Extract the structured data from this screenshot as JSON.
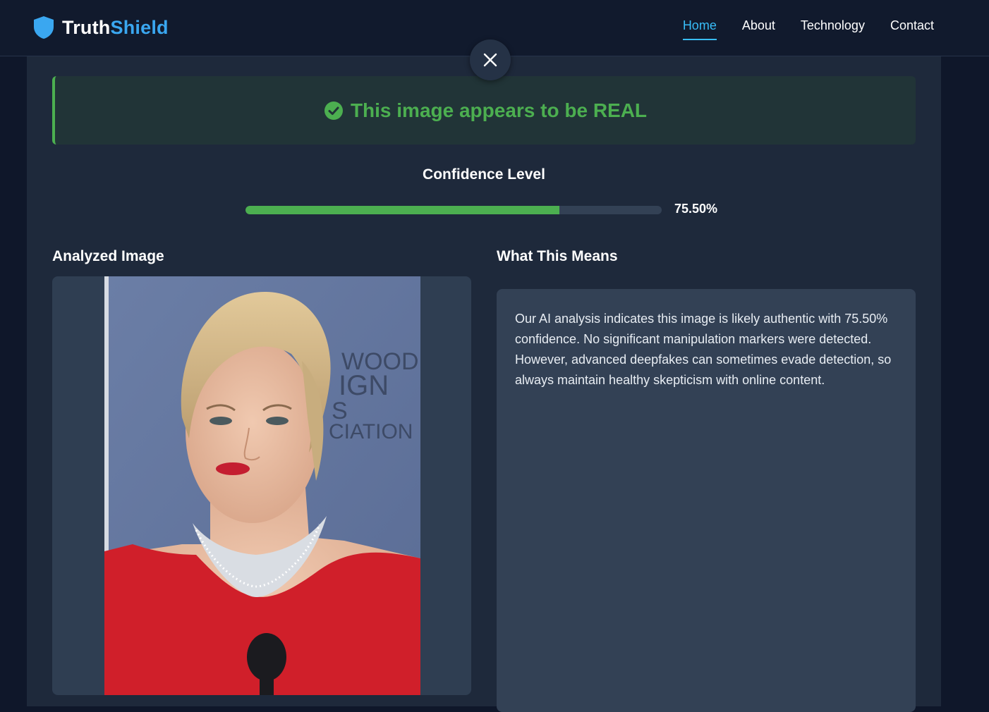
{
  "header": {
    "brand_part1": "Truth",
    "brand_part2": "Shield",
    "logo_icon": "shield-icon",
    "nav": [
      {
        "label": "Home",
        "active": true
      },
      {
        "label": "About",
        "active": false
      },
      {
        "label": "Technology",
        "active": false
      },
      {
        "label": "Contact",
        "active": false
      }
    ]
  },
  "modal": {
    "close_icon": "close-icon",
    "verdict": {
      "icon": "check-circle-icon",
      "text": "This image appears to be REAL",
      "color": "#4caf50"
    },
    "confidence": {
      "title": "Confidence Level",
      "value_label": "75.50%",
      "fraction": 0.755,
      "bar_color": "#4caf50"
    },
    "analyzed_image": {
      "title": "Analyzed Image",
      "backdrop_fragments": [
        "WOOD",
        "IGN",
        "S",
        "CIATION"
      ]
    },
    "meaning": {
      "title": "What This Means",
      "text": "Our AI analysis indicates this image is likely authentic with 75.50% confidence. No significant manipulation markers were detected. However, advanced deepfakes can sometimes evade detection, so always maintain healthy skepticism with online content."
    }
  },
  "colors": {
    "page_bg": "#0f172a",
    "panel_bg": "#1e293b",
    "accent_blue": "#38bdf8",
    "success_green": "#4caf50"
  }
}
